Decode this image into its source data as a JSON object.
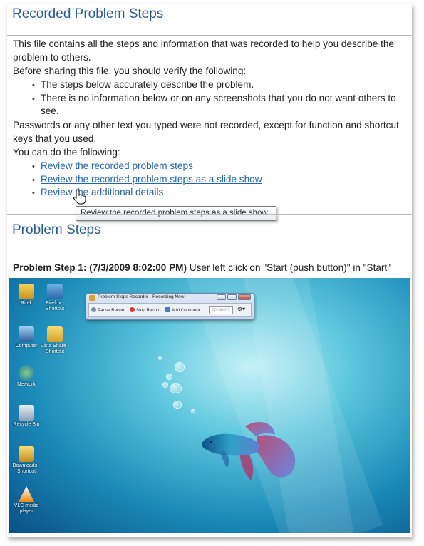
{
  "sections": {
    "recorded_title": "Recorded Problem Steps",
    "steps_title": "Problem Steps"
  },
  "intro": {
    "p1": "This file contains all the steps and information that was recorded to help you describe the problem to others.",
    "p2": "Before sharing this file, you should verify the following:",
    "checks": [
      "The steps below accurately describe the problem.",
      "There is no information below or on any screenshots that you do not want others to",
      "see."
    ],
    "p3": "Passwords or any other text you typed were not recorded, except for function and shortcut keys that you used.",
    "p4": "You can do the following:"
  },
  "links": [
    "Review the recorded problem steps",
    "Review the recorded problem steps as a slide show",
    "Review the additional details"
  ],
  "tooltip": "Review the recorded problem steps as a slide show",
  "step": {
    "heading": "Problem Step 1: (7/3/2009 8:02:00 PM)",
    "text": " User left click on \"Start (push button)\" in \"Start\""
  },
  "desktop": {
    "icons": [
      "Ritek",
      "Firefox - Shortcut",
      "Computer",
      "Vista Share - Shortcut",
      "Network",
      "Recycle Bin",
      "Downloads - Shortcut",
      "VLC media player"
    ],
    "recorder": {
      "title": "Problem Steps Recorder - Recording Now",
      "pause": "Pause Record",
      "stop": "Stop Record",
      "comment": "Add Comment",
      "time": "00:00:01"
    }
  },
  "colors": {
    "link": "#2566a8",
    "heading": "#2a5d8f"
  }
}
